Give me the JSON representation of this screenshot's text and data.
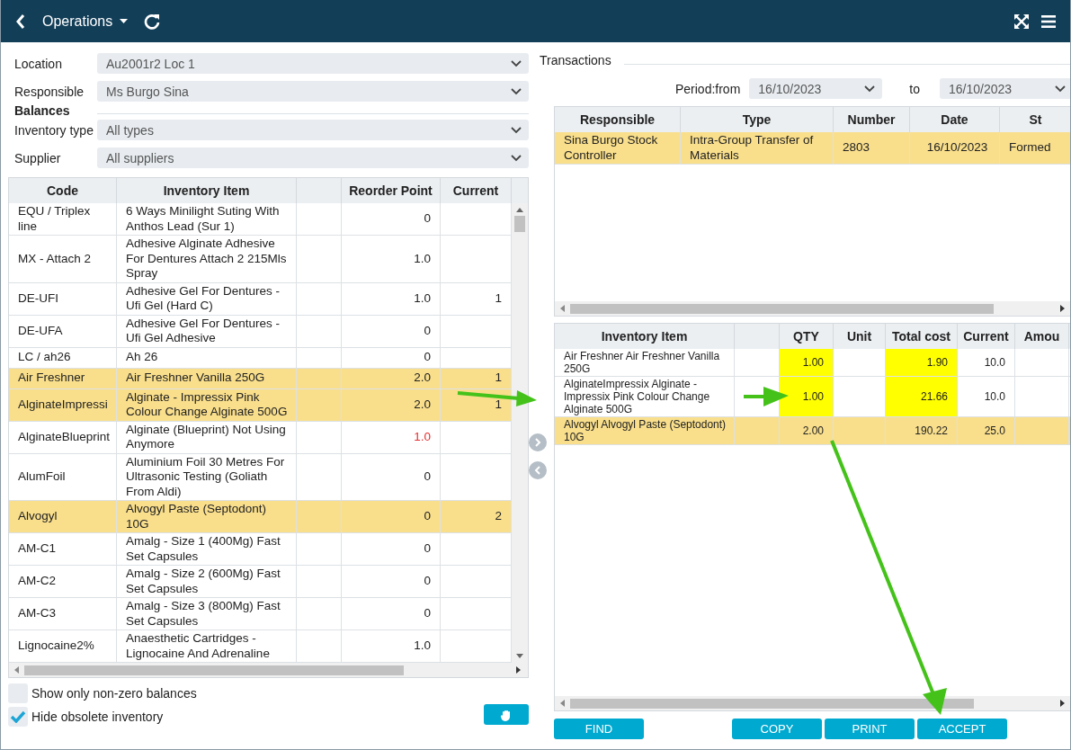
{
  "header": {
    "title": "Operations"
  },
  "filters": [
    {
      "label": "Location",
      "value": "Au2001r2 Loc 1"
    },
    {
      "label": "Responsible",
      "value": "Ms Burgo Sina"
    }
  ],
  "balances": {
    "title": "Balances",
    "filters": [
      {
        "label": "Inventory type",
        "value": "All types"
      },
      {
        "label": "Supplier",
        "value": "All suppliers"
      }
    ]
  },
  "inventory_table": {
    "columns": [
      {
        "kind": "text",
        "label": "Code"
      },
      {
        "kind": "text",
        "label": "Inventory Item"
      },
      {
        "kind": "spacer"
      },
      {
        "kind": "text",
        "label": "Reorder Point"
      },
      {
        "kind": "text",
        "label": "Current"
      }
    ],
    "rows": [
      {
        "code": "EQU / Triplex line",
        "item": "6 Ways Minilight Suting With Anthos Lead (Sur 1)",
        "reorder_point": "0",
        "current": "",
        "selected": false,
        "below_reorder": false
      },
      {
        "code": "MX - Attach 2",
        "item": "Adhesive Alginate Adhesive For Dentures Attach 2 215Mls Spray",
        "reorder_point": "1.0",
        "selected": false,
        "below_reorder": false
      },
      {
        "code": "DE-UFI",
        "item": "Adhesive Gel For Dentures - Ufi Gel (Hard C)",
        "reorder_point": "1.0",
        "current": "1",
        "selected": false,
        "below_reorder": false
      },
      {
        "code": "DE-UFA",
        "item": "Adhesive Gel For Dentures - Ufi Gel Adhesive",
        "reorder_point": "0",
        "selected": false,
        "below_reorder": false
      },
      {
        "code": "LC / ah26",
        "item": "Ah 26",
        "reorder_point": "0",
        "selected": false,
        "below_reorder": false
      },
      {
        "code": "Air Freshner",
        "item": "Air Freshner Vanilla 250G",
        "reorder_point": "2.0",
        "current": "1",
        "selected": true,
        "below_reorder": false
      },
      {
        "code": "AlginateImpressi",
        "item": "Alginate - Impressix Pink Colour Change Alginate 500G",
        "reorder_point": "2.0",
        "current": "1",
        "selected": true,
        "below_reorder": false
      },
      {
        "code": "AlginateBlueprint",
        "item": "Alginate (Blueprint) Not Using Anymore",
        "reorder_point": "1.0",
        "selected": false,
        "below_reorder": true
      },
      {
        "code": "AlumFoil",
        "item": "Aluminium Foil 30 Metres For Ultrasonic Testing (Goliath From Aldi)",
        "reorder_point": "0",
        "selected": false,
        "below_reorder": false
      },
      {
        "code": "Alvogyl",
        "item": "Alvogyl Paste (Septodont) 10G",
        "reorder_point": "0",
        "current": "2",
        "selected": true,
        "below_reorder": false
      },
      {
        "code": "AM-C1",
        "item": "Amalg - Size 1 (400Mg) Fast Set Capsules",
        "reorder_point": "0",
        "selected": false,
        "below_reorder": false
      },
      {
        "code": "AM-C2",
        "item": "Amalg - Size 2 (600Mg) Fast Set Capsules",
        "reorder_point": "0",
        "selected": false,
        "below_reorder": false
      },
      {
        "code": "AM-C3",
        "item": "Amalg - Size 3 (800Mg) Fast Set Capsules",
        "reorder_point": "0",
        "selected": false,
        "below_reorder": false
      },
      {
        "code": "Lignocaine2%",
        "item": "Anaesthetic Cartridges - Lignocaine And Adrenaline",
        "reorder_point": "1.0",
        "selected": false,
        "below_reorder": false
      }
    ]
  },
  "checkboxes": [
    {
      "label": "Show only non-zero balances",
      "checked": false
    },
    {
      "label": "Hide obsolete inventory",
      "checked": true
    }
  ],
  "transactions": {
    "title": "Transactions",
    "period_label": "Period:from",
    "from": "16/10/2023",
    "to_label": "to",
    "to": "16/10/2023",
    "columns": [
      "Responsible",
      "Type",
      "Number",
      "Date",
      "St"
    ],
    "rows": [
      {
        "responsible": "Sina Burgo Stock Controller",
        "type": "Intra-Group Transfer of Materials",
        "number": "2803",
        "date": "16/10/2023",
        "status": "Formed",
        "selected": true
      }
    ]
  },
  "lines_table": {
    "columns": [
      {
        "kind": "text",
        "label": "Inventory Item"
      },
      {
        "kind": "spacer"
      },
      {
        "kind": "text",
        "label": "QTY"
      },
      {
        "kind": "text",
        "label": "Unit"
      },
      {
        "kind": "text",
        "label": "Total cost"
      },
      {
        "kind": "text",
        "label": "Current"
      },
      {
        "kind": "text",
        "label": "Amou"
      }
    ],
    "rows": [
      {
        "item": "Air Freshner Air Freshner Vanilla 250G",
        "qty": "1.00",
        "total_cost": "1.90",
        "current": "10.0",
        "selected": false,
        "editable": true
      },
      {
        "item": "AlginateImpressix Alginate - Impressix Pink Colour Change Alginate 500G",
        "qty": "1.00",
        "total_cost": "21.66",
        "current": "10.0",
        "selected": false,
        "editable": true
      },
      {
        "item": "Alvogyl Alvogyl Paste (Septodont) 10G",
        "qty": "2.00",
        "total_cost": "190.22",
        "current": "25.0",
        "selected": true,
        "editable": false
      }
    ]
  },
  "left_buttons": [
    "FIND"
  ],
  "right_buttons": [
    "COPY",
    "PRINT",
    "ACCEPT"
  ]
}
